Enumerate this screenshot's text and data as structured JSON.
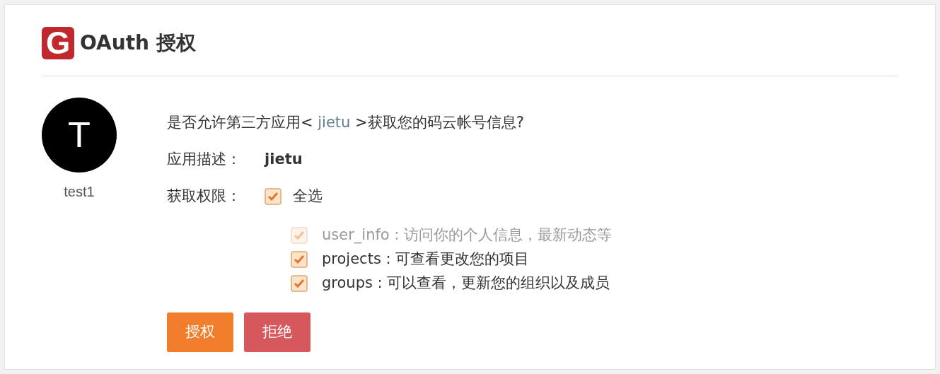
{
  "header": {
    "logo_letter": "G",
    "title": "OAuth 授权"
  },
  "user": {
    "avatar_letter": "T",
    "name": "test1"
  },
  "question": {
    "prefix": "是否允许第三方应用< ",
    "app": "jietu",
    "suffix": " >获取您的码云帐号信息?"
  },
  "description": {
    "label": "应用描述：",
    "value": "jietu"
  },
  "permissions": {
    "label": "获取权限：",
    "select_all": {
      "label": "全选",
      "checked": true
    },
    "items": [
      {
        "name": "user_info",
        "text": " : 访问你的个人信息，最新动态等",
        "checked": true,
        "disabled": true
      },
      {
        "name": "projects",
        "text": " : 可查看更改您的项目",
        "checked": true,
        "disabled": false
      },
      {
        "name": "groups",
        "text": " : 可以查看，更新您的组织以及成员",
        "checked": true,
        "disabled": false
      }
    ]
  },
  "buttons": [
    {
      "label": "授权",
      "kind": "primary"
    },
    {
      "label": "拒绝",
      "kind": "danger"
    }
  ]
}
